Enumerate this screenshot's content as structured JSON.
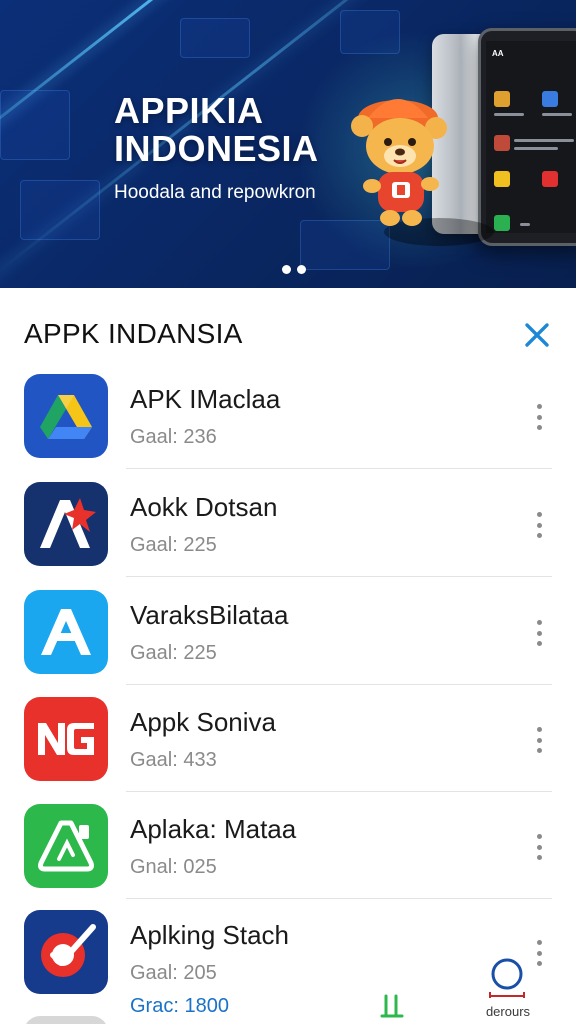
{
  "banner": {
    "title_line1": "APPIKIA",
    "title_line2": "INDONESIA",
    "subtitle": "Hoodala and repowkron",
    "phone_title": "AA",
    "carousel_dots": 2
  },
  "sheet": {
    "title": "APPK INDANSIA",
    "close_label": "×"
  },
  "apps": [
    {
      "name": "APK IMaclaa",
      "meta": "Gaal: 236",
      "icon": "drive-triangle-icon",
      "color": "#2255c4"
    },
    {
      "name": "Aokk Dotsan",
      "meta": "Gaal: 225",
      "icon": "red-star-a-icon",
      "color": "#15316e"
    },
    {
      "name": "VaraksBilataa",
      "meta": "Gaal: 225",
      "icon": "a-logo-icon",
      "color": "#1aa7f0"
    },
    {
      "name": "Appk Soniva",
      "meta": "Gaal: 433",
      "icon": "ng-logo-icon",
      "color": "#e8312b"
    },
    {
      "name": "Aplaka: Mataa",
      "meta": "Gnal: 025",
      "icon": "green-triangle-icon",
      "color": "#2cb84a"
    },
    {
      "name": "Aplking Stach",
      "meta": "Gaal: 205",
      "icon": "red-check-icon",
      "color": "#163a8c"
    }
  ],
  "bottom": {
    "stat": "Grac: 1800",
    "nav_a_icon": "bars-icon",
    "nav_b_icon": "circle-icon",
    "nav_b_label": "derours"
  }
}
